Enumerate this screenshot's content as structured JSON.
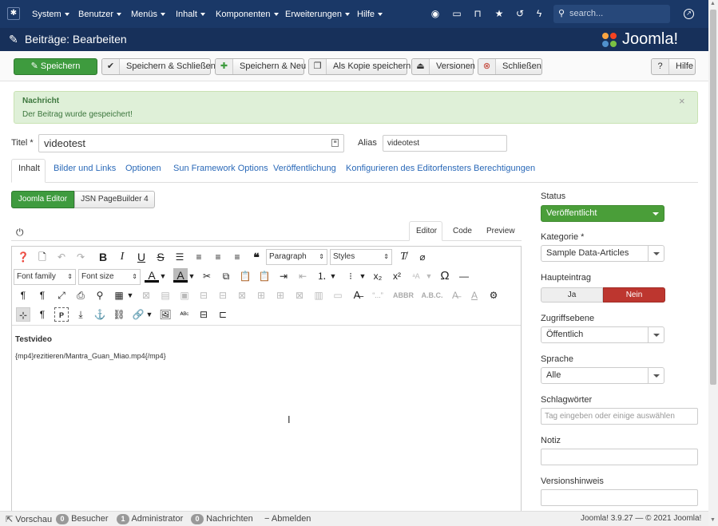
{
  "nav": {
    "menus": [
      "System",
      "Benutzer",
      "Menüs",
      "Inhalt",
      "Komponenten",
      "Erweiterungen",
      "Hilfe"
    ],
    "search_placeholder": "search..."
  },
  "header": {
    "title": "Beiträge: Bearbeiten",
    "logo": "Joomla!"
  },
  "toolbar": {
    "save": "Speichern",
    "save_close": "Speichern & Schließen",
    "save_new": "Speichern & Neu",
    "save_copy": "Als Kopie speichern",
    "versions": "Versionen",
    "close": "Schließen",
    "help": "Hilfe"
  },
  "message": {
    "heading": "Nachricht",
    "text": "Der Beitrag wurde gespeichert!",
    "close": "×"
  },
  "form": {
    "title_label": "Titel *",
    "title_value": "videotest",
    "alias_label": "Alias",
    "alias_value": "videotest"
  },
  "tabs": [
    "Inhalt",
    "Bilder und Links",
    "Optionen",
    "Sun Framework Options",
    "Veröffentlichung",
    "Konfigurieren des Editorfensters",
    "Berechtigungen"
  ],
  "editor": {
    "switch": [
      "Joomla Editor",
      "JSN PageBuilder 4"
    ],
    "modes": [
      "Editor",
      "Code",
      "Preview"
    ],
    "paragraph": "Paragraph",
    "styles": "Styles",
    "font_family": "Font family",
    "font_size": "Font size",
    "content_heading": "Testvideo",
    "content_text": "{mp4}rezitieren/Mantra_Guan_Miao.mp4{/mp4}",
    "quote_sym": "“...”",
    "abbr": "ABBR",
    "abc": "A.B.C."
  },
  "sidebar": {
    "status_label": "Status",
    "status_value": "Veröffentlicht",
    "category_label": "Kategorie *",
    "category_value": "Sample Data-Articles",
    "featured_label": "Haupteintrag",
    "featured_yes": "Ja",
    "featured_no": "Nein",
    "access_label": "Zugriffsebene",
    "access_value": "Öffentlich",
    "language_label": "Sprache",
    "language_value": "Alle",
    "tags_label": "Schlagwörter",
    "tags_placeholder": "Tag eingeben oder einige auswählen",
    "note_label": "Notiz",
    "version_label": "Versionshinweis"
  },
  "status": {
    "preview": "Vorschau",
    "visitors_count": "0",
    "visitors": "Besucher",
    "admin_count": "1",
    "admin": "Administrator",
    "messages_count": "0",
    "messages": "Nachrichten",
    "logout": "Abmelden",
    "copyright": "Joomla! 3.9.27 — © 2021 Joomla!"
  },
  "colors": {
    "nav": "#1a3867",
    "save": "#3e9b3e",
    "published": "#4a9e39",
    "no": "#bd362f",
    "message_bg": "#dff0d8"
  }
}
